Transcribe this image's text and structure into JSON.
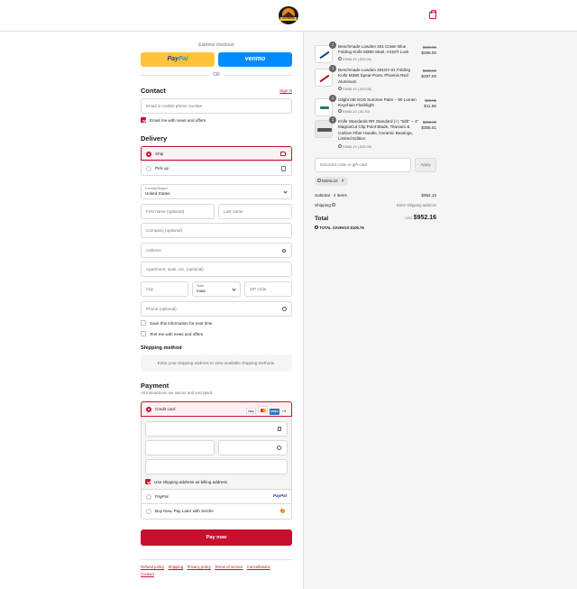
{
  "header": {
    "logo_text": "OUTDOOR",
    "cart_icon": "shopping-bag-icon"
  },
  "express": {
    "title": "Express checkout",
    "paypal_a": "Pay",
    "paypal_b": "Pal",
    "venmo": "venmo",
    "or": "OR"
  },
  "contact": {
    "title": "Contact",
    "signin": "Sign in",
    "email_placeholder": "Email or mobile phone number",
    "news_label": "Email me with news and offers",
    "news_checked": true
  },
  "delivery": {
    "title": "Delivery",
    "ship": "Ship",
    "pickup": "Pick up",
    "country_label": "Country/Region",
    "country": "United States",
    "first_name": "First name (optional)",
    "last_name": "Last name",
    "company": "Company (optional)",
    "address": "Address",
    "apartment": "Apartment, suite, etc. (optional)",
    "city": "City",
    "state_label": "State",
    "state": "Iowa",
    "zip": "ZIP code",
    "phone": "Phone (optional)",
    "save_info": "Save this information for next time",
    "text_me": "Text me with news and offers"
  },
  "shipping_method": {
    "title": "Shipping method",
    "message": "Enter your shipping address to view available shipping methods."
  },
  "payment": {
    "title": "Payment",
    "subtitle": "All transactions are secure and encrypted.",
    "credit_card": "Credit card",
    "card_visa": "VISA",
    "card_amex": "AMEX",
    "more_cards": "+3",
    "billing_same": "Use shipping address as billing address",
    "paypal": "PayPal",
    "sezzle": "Buy Now, Pay Later with Sezzle"
  },
  "pay_now": "Pay now",
  "footer": {
    "links": [
      "Refund policy",
      "Shipping",
      "Privacy policy",
      "Terms of service",
      "Cancellations",
      "Contact"
    ]
  },
  "order": {
    "items": [
      {
        "qty": "1",
        "name": "Benchmade Lowden 491 Crater Blue Folding Knife M390 Steel, AXIS® Lock",
        "discount": "EMAIL10 (-$32.00)",
        "original": "$320.00",
        "price": "$288.00"
      },
      {
        "qty": "1",
        "name": "Benchmade Lowden 491GY-01 Folding Knife M390 Spear-Point, Phoenix Red Aluminum",
        "discount": "EMAIL10 (-$33.00)",
        "original": "$330.00",
        "price": "$297.00"
      },
      {
        "qty": "1",
        "name": "Olight i3E EOS Summer Palm – 90 Lumen Keychain Flashlight",
        "discount": "EMAIL10 (-$1.30)",
        "original": "$12.95",
        "price": "$11.65"
      },
      {
        "qty": "1",
        "name": "Knife Standards RR Standard (+) \"Sith\" – 4\" MagnaCut Clip Point Blade, Titanium & Carbon Fiber Handle, Ceramic Bearings, Limited Edition",
        "discount": "EMAIL10 (-$39.49)",
        "original": "$395.00",
        "price": "$355.51"
      }
    ],
    "discount_placeholder": "Discount code or gift card",
    "apply": "Apply",
    "applied_code": "EMAIL10",
    "subtotal_label": "Subtotal · 4 items",
    "subtotal": "$952.16",
    "shipping_label": "Shipping",
    "shipping_value": "Enter shipping address",
    "total_label": "Total",
    "currency": "USD",
    "total": "$952.16",
    "savings_label": "TOTAL SAVINGS",
    "savings": "$105.79"
  },
  "colors": {
    "accent": "#c8102e",
    "paypal": "#ffc439",
    "venmo": "#008cff"
  }
}
